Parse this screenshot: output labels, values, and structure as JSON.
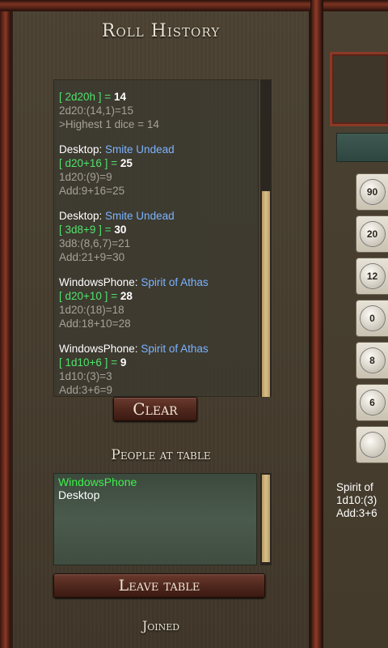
{
  "title": "Roll History",
  "history": [
    {
      "who": "",
      "name": "",
      "expr": "[ 2d20h ]",
      "result": "14",
      "details": [
        "2d20:(14,1)=15",
        ">Highest 1 dice = 14"
      ]
    },
    {
      "who": "Desktop:",
      "name": "Smite Undead",
      "expr": "[ d20+16 ]",
      "result": "25",
      "details": [
        "1d20:(9)=9",
        "Add:9+16=25"
      ]
    },
    {
      "who": "Desktop:",
      "name": "Smite Undead",
      "expr": "[ 3d8+9 ]",
      "result": "30",
      "details": [
        "3d8:(8,6,7)=21",
        "Add:21+9=30"
      ]
    },
    {
      "who": "WindowsPhone:",
      "name": "Spirit of Athas",
      "expr": "[ d20+10 ]",
      "result": "28",
      "details": [
        "1d20:(18)=18",
        "Add:18+10=28"
      ]
    },
    {
      "who": "WindowsPhone:",
      "name": "Spirit of Athas",
      "expr": "[ 1d10+6 ]",
      "result": "9",
      "details": [
        "1d10:(3)=3",
        "Add:3+6=9"
      ]
    }
  ],
  "buttons": {
    "clear": "Clear",
    "leave": "Leave table"
  },
  "people_title": "People at table",
  "people": [
    "WindowsPhone",
    "Desktop"
  ],
  "joined_label": "Joined",
  "dice": [
    {
      "label": "90",
      "icon": "d100-icon"
    },
    {
      "label": "20",
      "icon": "d20-icon"
    },
    {
      "label": "12",
      "icon": "d12-icon"
    },
    {
      "label": "0",
      "icon": "d10-icon"
    },
    {
      "label": "8",
      "icon": "d8-icon"
    },
    {
      "label": "6",
      "icon": "d6-icon"
    },
    {
      "label": "",
      "icon": "d4-icon"
    }
  ],
  "right_log": [
    "Spirit of",
    "1d10:(3)",
    "Add:3+6"
  ]
}
